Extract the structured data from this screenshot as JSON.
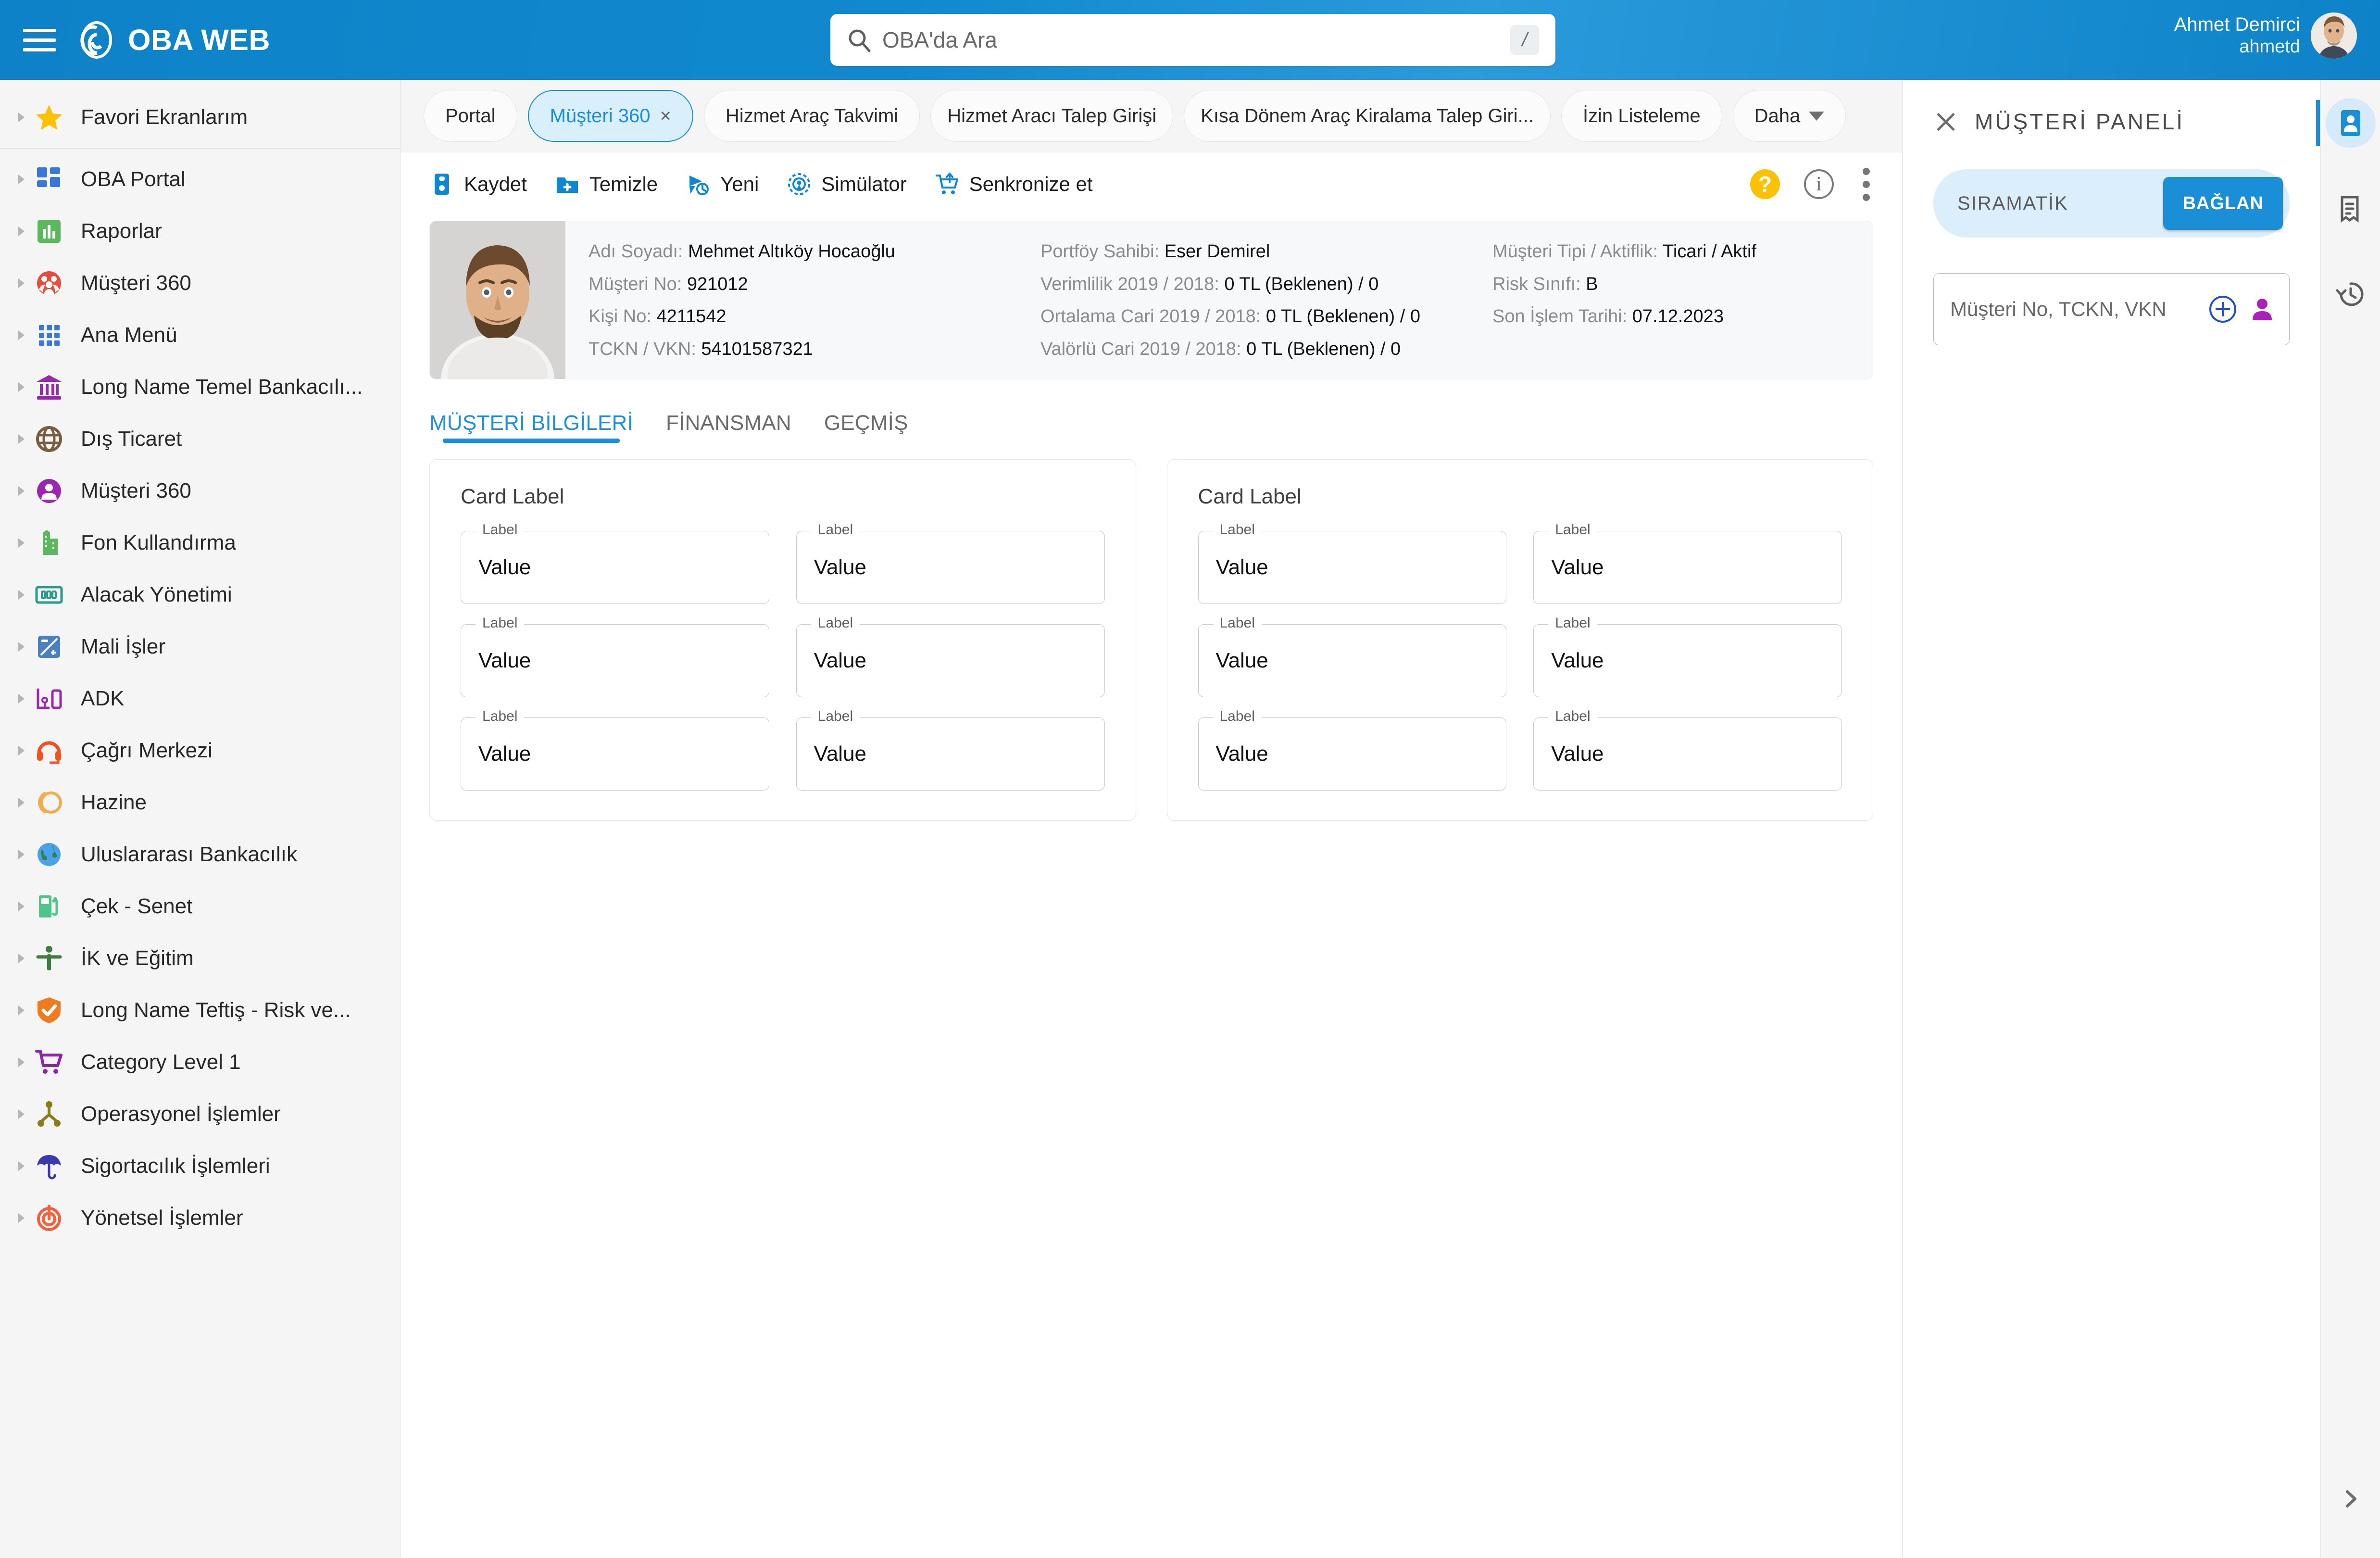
{
  "header": {
    "menu_icon": "hamburger-icon",
    "logo_icon": "oba-spiral-logo",
    "brand": "OBA WEB",
    "search": {
      "icon": "search-icon",
      "placeholder": "OBA'da Ara",
      "value": "",
      "shortcut_key": "/"
    },
    "user": {
      "name": "Ahmet Demirci",
      "handle": "ahmetd",
      "avatar_icon": "user-avatar"
    },
    "brand_color": "#0d82c8"
  },
  "sidebar": {
    "items": [
      {
        "label": "Favori Ekranlarım",
        "icon": "star-icon",
        "color": "#ffc107",
        "divider_after": true
      },
      {
        "label": "OBA Portal",
        "icon": "dashboard-grid-icon",
        "color": "#3b77d8"
      },
      {
        "label": "Raporlar",
        "icon": "bar-chart-icon",
        "color": "#5cb85c"
      },
      {
        "label": "Müşteri 360",
        "icon": "people-circle-icon",
        "color": "#e74c3c"
      },
      {
        "label": "Ana Menü",
        "icon": "apps-grid-icon",
        "color": "#3b77d8"
      },
      {
        "label": "Long Name Temel Bankacılı...",
        "icon": "bank-icon",
        "color": "#9b27b0"
      },
      {
        "label": "Dış Ticaret",
        "icon": "globe-grid-icon",
        "color": "#7a5c3e"
      },
      {
        "label": "Müşteri 360",
        "icon": "person-circle-icon",
        "color": "#9b27b0"
      },
      {
        "label": "Fon Kullandırma",
        "icon": "building-icon",
        "color": "#5cb85c"
      },
      {
        "label": "Alacak Yönetimi",
        "icon": "banknote-icon",
        "color": "#2a9a8f"
      },
      {
        "label": "Mali İşler",
        "icon": "calculator-icon",
        "color": "#4a7fc1"
      },
      {
        "label": "ADK",
        "icon": "devices-icon",
        "color": "#9b27b0"
      },
      {
        "label": "Çağrı Merkezi",
        "icon": "headset-icon",
        "color": "#f4511e"
      },
      {
        "label": "Hazine",
        "icon": "treasury-arc-icon",
        "color": "#f0ad4e"
      },
      {
        "label": "Uluslararası Bankacılık",
        "icon": "earth-icon",
        "color": "#4aa3e8"
      },
      {
        "label": "Çek - Senet",
        "icon": "fuel-note-icon",
        "color": "#4ec58a"
      },
      {
        "label": "İK ve Eğitim",
        "icon": "person-arms-icon",
        "color": "#3e7d3e"
      },
      {
        "label": "Long Name Teftiş - Risk ve...",
        "icon": "shield-check-icon",
        "color": "#f07a1e"
      },
      {
        "label": "Category Level 1",
        "icon": "shopping-cart-icon",
        "color": "#8e24aa"
      },
      {
        "label": "Operasyonel İşlemler",
        "icon": "hierarchy-icon",
        "color": "#8a7b16"
      },
      {
        "label": "Sigortacılık İşlemleri",
        "icon": "umbrella-icon",
        "color": "#3a3ab0"
      },
      {
        "label": "Yönetsel İşlemler",
        "icon": "target-power-icon",
        "color": "#f4603a"
      }
    ],
    "caret_icon": "chevron-right-icon"
  },
  "tabs": [
    {
      "label": "Portal",
      "active": false,
      "closable": false,
      "two_line": false
    },
    {
      "label": "Müşteri 360",
      "active": true,
      "closable": true,
      "close_label": "×",
      "two_line": false
    },
    {
      "label": "Hizmet Araç Takvimi",
      "active": false,
      "closable": false,
      "two_line": false
    },
    {
      "label": "Hizmet Aracı Talep Girişi",
      "active": false,
      "closable": false,
      "two_line": true
    },
    {
      "label": "Kısa Dönem Araç Kiralama Talep Giri...",
      "active": false,
      "closable": false,
      "two_line": true
    },
    {
      "label": "İzin Listeleme",
      "active": false,
      "closable": false,
      "two_line": false
    },
    {
      "label": "Daha",
      "active": false,
      "closable": false,
      "two_line": false,
      "dropdown": true
    }
  ],
  "toolbar": {
    "actions": [
      {
        "label": "Kaydet",
        "icon": "save-icon"
      },
      {
        "label": "Temizle",
        "icon": "folder-plus-icon"
      },
      {
        "label": "Yeni",
        "icon": "new-clock-icon"
      },
      {
        "label": "Simülator",
        "icon": "simulator-target-icon"
      },
      {
        "label": "Senkronize et",
        "icon": "sync-cart-icon"
      }
    ],
    "help_icon": "help-question-icon",
    "help_glyph": "?",
    "info_icon": "info-circle-icon",
    "info_glyph": "i",
    "more_icon": "kebab-menu-icon",
    "accent": "#1a8fd8"
  },
  "customer": {
    "photo_icon": "customer-photo",
    "fields_col1": [
      {
        "key": "Adı Soyadı:",
        "value": "Mehmet Altıköy Hocaoğlu"
      },
      {
        "key": "Müşteri No:",
        "value": "921012"
      },
      {
        "key": "Kişi No:",
        "value": "4211542"
      },
      {
        "key": "TCKN / VKN:",
        "value": "54101587321"
      }
    ],
    "fields_col2": [
      {
        "key": "Portföy Sahibi:",
        "value": "Eser Demirel"
      },
      {
        "key": "Verimlilik 2019 / 2018:",
        "value": "0 TL (Beklenen) / 0"
      },
      {
        "key": "Ortalama Cari 2019 / 2018:",
        "value": "0 TL (Beklenen) / 0"
      },
      {
        "key": "Valörlü Cari 2019 / 2018:",
        "value": "0 TL (Beklenen) / 0"
      }
    ],
    "fields_col3": [
      {
        "key": "Müşteri Tipi / Aktiflik:",
        "value": "Ticari / Aktif"
      },
      {
        "key": "Risk Sınıfı:",
        "value": "B"
      },
      {
        "key": "Son İşlem Tarihi:",
        "value": "07.12.2023"
      }
    ]
  },
  "inner_tabs": [
    {
      "label": "MÜŞTERİ BİLGİLERİ",
      "active": true
    },
    {
      "label": "FİNANSMAN",
      "active": false
    },
    {
      "label": "GEÇMİŞ",
      "active": false
    }
  ],
  "cards": [
    {
      "title": "Card Label",
      "fields": [
        {
          "label": "Label",
          "value": "Value"
        },
        {
          "label": "Label",
          "value": "Value"
        },
        {
          "label": "Label",
          "value": "Value"
        },
        {
          "label": "Label",
          "value": "Value"
        },
        {
          "label": "Label",
          "value": "Value"
        },
        {
          "label": "Label",
          "value": "Value"
        }
      ]
    },
    {
      "title": "Card Label",
      "fields": [
        {
          "label": "Label",
          "value": "Value"
        },
        {
          "label": "Label",
          "value": "Value"
        },
        {
          "label": "Label",
          "value": "Value"
        },
        {
          "label": "Label",
          "value": "Value"
        },
        {
          "label": "Label",
          "value": "Value"
        },
        {
          "label": "Label",
          "value": "Value"
        }
      ]
    }
  ],
  "right_panel": {
    "close_icon": "close-icon",
    "title": "MÜŞTERİ PANELİ",
    "siramatik": {
      "label": "SIRAMATİK",
      "button_label": "BAĞLAN"
    },
    "search": {
      "placeholder": "Müşteri No, TCKN, VKN",
      "value": "",
      "plus_icon": "plus-circle-icon",
      "person_icon": "person-icon"
    }
  },
  "rail": {
    "buttons": [
      {
        "icon": "contact-card-icon",
        "active": true
      },
      {
        "icon": "receipt-icon",
        "active": false
      },
      {
        "icon": "history-clock-icon",
        "active": false
      }
    ],
    "expand_icon": "chevron-right-icon"
  }
}
